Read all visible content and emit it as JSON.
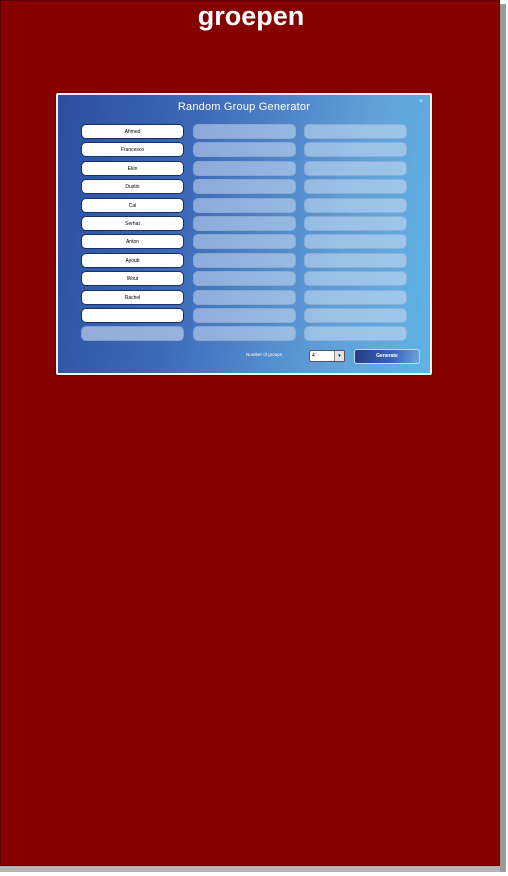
{
  "page": {
    "title": "groepen"
  },
  "widget": {
    "title": "Random Group Generator",
    "close_label": "×",
    "names": [
      "Ahmed",
      "Francesco",
      "Ekin",
      "Dustin",
      "Cal",
      "Serhat",
      "Anton",
      "Ayoub",
      "Wout",
      "Rachel",
      "",
      ""
    ],
    "group_cells_per_column": 12,
    "groups_label": "Number of groups",
    "groups_value": "4",
    "generate_label": "Generate"
  },
  "colors": {
    "page_bg": "#870000",
    "widget_gradient_start": "#2a4f9e",
    "widget_gradient_end": "#5fb3e6",
    "title_text": "#ffffff"
  }
}
